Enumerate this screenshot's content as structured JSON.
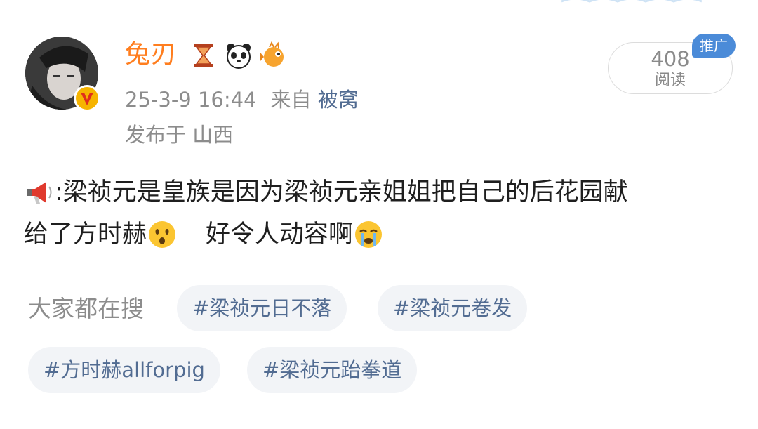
{
  "post": {
    "username": "兔刃",
    "date": "25-3-9 16:44",
    "from_label": "来自",
    "source": "被窝",
    "location_label": "发布于",
    "location": "山西",
    "medals": [
      "hourglass-icon",
      "panda-icon",
      "pufferfish-icon"
    ],
    "read_count": "408",
    "read_label": "阅读",
    "promo_label": "推广",
    "text_line1": ":梁祯元是皇族是因为梁祯元亲姐姐把自己的后花园献",
    "text_line2a": "给了方时赫",
    "text_line2b": "好令人动容啊"
  },
  "hot_search": {
    "label": "大家都在搜",
    "tags": [
      "#梁祯元日不落",
      "#梁祯元卷发",
      "#方时赫allforpig",
      "#梁祯元跆拳道"
    ]
  },
  "colors": {
    "username": "#ff7e1f",
    "link": "#526c92",
    "meta": "#8c8c8c",
    "promo_bg": "#4b8bd8",
    "tag_bg": "#f2f4f7"
  }
}
